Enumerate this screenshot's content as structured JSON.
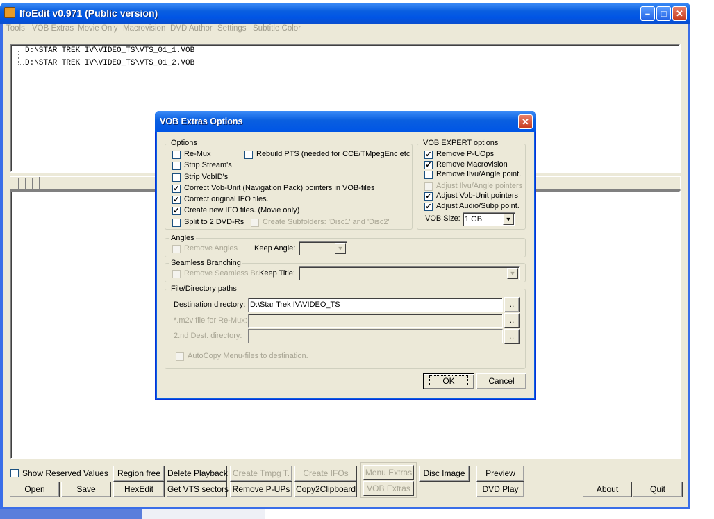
{
  "app": {
    "title": "IfoEdit v0.971 (Public version)",
    "minimize_glyph": "–",
    "maximize_glyph": "□",
    "close_glyph": "✕"
  },
  "menu": [
    "Tools",
    "VOB Extras",
    "Movie Only",
    "Macrovision",
    "DVD Author",
    "Settings",
    "Subtitle Color"
  ],
  "files": [
    "D:\\STAR TREK IV\\VIDEO_TS\\VTS_01_1.VOB",
    "D:\\STAR TREK IV\\VIDEO_TS\\VTS_01_2.VOB"
  ],
  "dialog": {
    "title": "VOB Extras Options",
    "close_glyph": "✕",
    "options": {
      "legend": "Options",
      "remux": "Re-Mux",
      "rebuild_pts": "Rebuild PTS (needed for CCE/TMpegEnc etc",
      "strip_streams": "Strip Stream's",
      "strip_vobids": "Strip VobID's",
      "correct_vobu": "Correct Vob-Unit (Navigation Pack) pointers in VOB-files",
      "correct_ifo": "Correct original IFO files.",
      "create_ifo": "Create new IFO files. (Movie only)",
      "split": "Split to 2 DVD-Rs",
      "subfolders": "Create Subfolders: 'Disc1' and 'Disc2'",
      "check_glyph": "✓"
    },
    "expert": {
      "legend": "VOB EXPERT options",
      "remove_puops": "Remove P-UOps",
      "remove_macrovision": "Remove Macrovision",
      "remove_ilvu": "Remove Ilvu/Angle point.",
      "adjust_ilvu": "Adjust Ilvu/Angle pointers",
      "adjust_vobu": "Adjust Vob-Unit pointers",
      "adjust_audio": "Adjust Audio/Subp point.",
      "vob_size_label": "VOB Size:",
      "vob_size_value": "1 GB"
    },
    "angles": {
      "legend": "Angles",
      "remove": "Remove Angles",
      "keep_label": "Keep Angle:",
      "keep_value": ""
    },
    "seamless": {
      "legend": "Seamless Branching",
      "remove": "Remove Seamless Br.",
      "keep_label": "Keep Title:",
      "keep_value": ""
    },
    "paths": {
      "legend": "File/Directory paths",
      "dest_label": "Destination directory:",
      "dest_value": "D:\\Star Trek IV\\VIDEO_TS",
      "m2v_label": "*.m2v file for Re-Mux:",
      "m2v_value": "",
      "dest2_label": "2.nd Dest. directory:",
      "dest2_value": "",
      "browse": "..",
      "autocopy": "AutoCopy Menu-files to destination."
    },
    "ok": "OK",
    "cancel": "Cancel",
    "dropdown_glyph": "▼"
  },
  "bottom": {
    "show_reserved": "Show Reserved Values",
    "open": "Open",
    "save": "Save",
    "region_free": "Region free",
    "hexedit": "HexEdit",
    "delete_playback": "Delete Playback",
    "get_vts": "Get VTS sectors",
    "create_tmpg": "Create Tmpg T.",
    "remove_puops": "Remove P-UPs",
    "create_ifos": "Create IFOs",
    "copy2clip": "Copy2Clipboard",
    "menu_extras": "Menu Extras",
    "vob_extras": "VOB Extras",
    "disc_image": "Disc Image",
    "preview": "Preview",
    "dvd_play": "DVD Play",
    "about": "About",
    "quit": "Quit"
  }
}
